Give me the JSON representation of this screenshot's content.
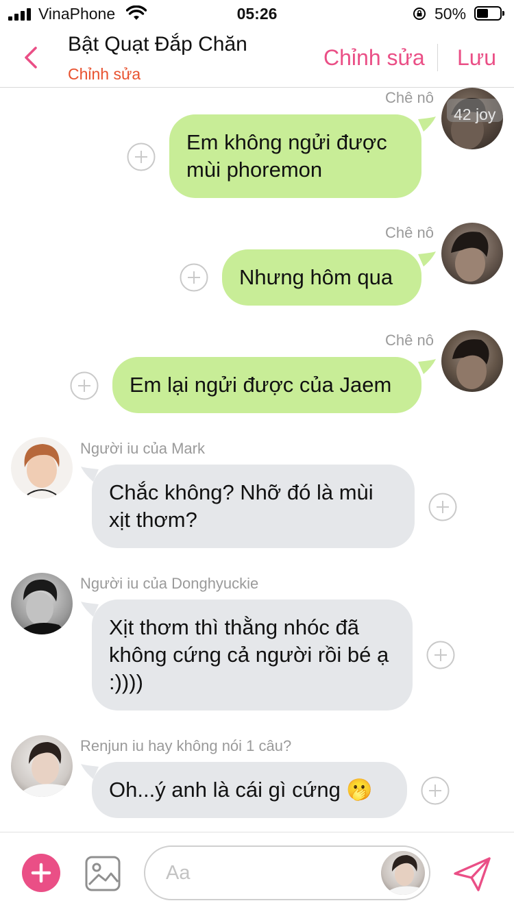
{
  "status_bar": {
    "carrier": "VinaPhone",
    "time": "05:26",
    "battery": "50%",
    "battery_level": 0.5
  },
  "header": {
    "title": "Bật Quạt Đắp Chăn",
    "subtitle": "Chỉnh sửa",
    "edit_label": "Chỉnh sửa",
    "save_label": "Lưu"
  },
  "messages": [
    {
      "direction": "outgoing",
      "sender": "Chê nô",
      "text": "Em không ngửi được mùi phoremon",
      "avatar_overlay": "42 joy"
    },
    {
      "direction": "outgoing",
      "sender": "Chê nô",
      "text": "Nhưng hôm qua"
    },
    {
      "direction": "outgoing",
      "sender": "Chê nô",
      "text": "Em lại ngửi được của Jaem"
    },
    {
      "direction": "incoming",
      "sender": "Người iu của Mark",
      "text": "Chắc không? Nhỡ đó là mùi xịt thơm?"
    },
    {
      "direction": "incoming",
      "sender": "Người iu của Donghyuckie",
      "text": "Xịt thơm thì thằng nhóc đã không cứng cả người rồi bé ạ :))))"
    },
    {
      "direction": "incoming",
      "sender": "Renjun iu hay không nói 1 câu?",
      "text": "Oh...ý anh là cái gì cứng 🫢"
    }
  ],
  "composer": {
    "placeholder": "Aa"
  },
  "colors": {
    "accent": "#ea4f86",
    "subtitle": "#e8512e",
    "outgoing_bubble": "#c8ed97",
    "incoming_bubble": "#e5e7ea"
  }
}
